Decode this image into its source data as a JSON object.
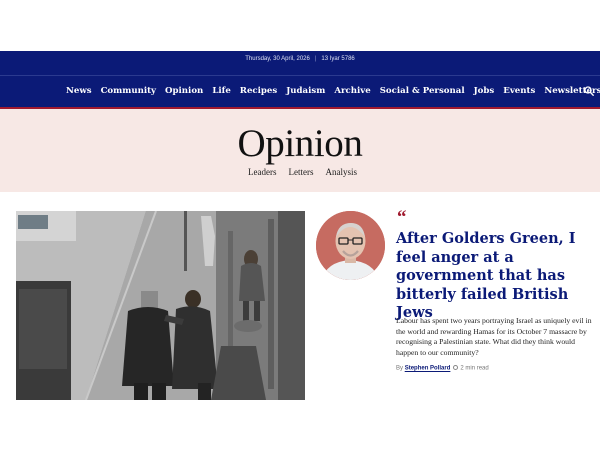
{
  "topbar": {
    "date": "Thursday, 30 April, 2026",
    "hebrew_date": "13 Iyar 5786",
    "nav_items": [
      "News",
      "Community",
      "Opinion",
      "Life",
      "Recipes",
      "Judaism",
      "Archive",
      "Social & Personal",
      "Jobs",
      "Events",
      "Newsletters"
    ],
    "search_icon": "search-icon"
  },
  "section": {
    "title": "Opinion",
    "subnav": [
      "Leaders",
      "Letters",
      "Analysis"
    ]
  },
  "article": {
    "quote_icon": "quote-icon",
    "headline": "After Golders Green, I feel anger at a government that has bitterly failed British Jews",
    "standfirst": "Labour has spent two years portraying Israel as uniquely evil in the world and rewarding Hamas for its October 7 massacre by recognising a Palestinian state. What did they think would happen to our community?",
    "byline_prefix": "By",
    "author": "Stephen Pollard",
    "read_time": "2 min read"
  },
  "colors": {
    "navy": "#0b1a77",
    "accent_red": "#a0192e",
    "hero_bg": "#f7e8e5"
  }
}
